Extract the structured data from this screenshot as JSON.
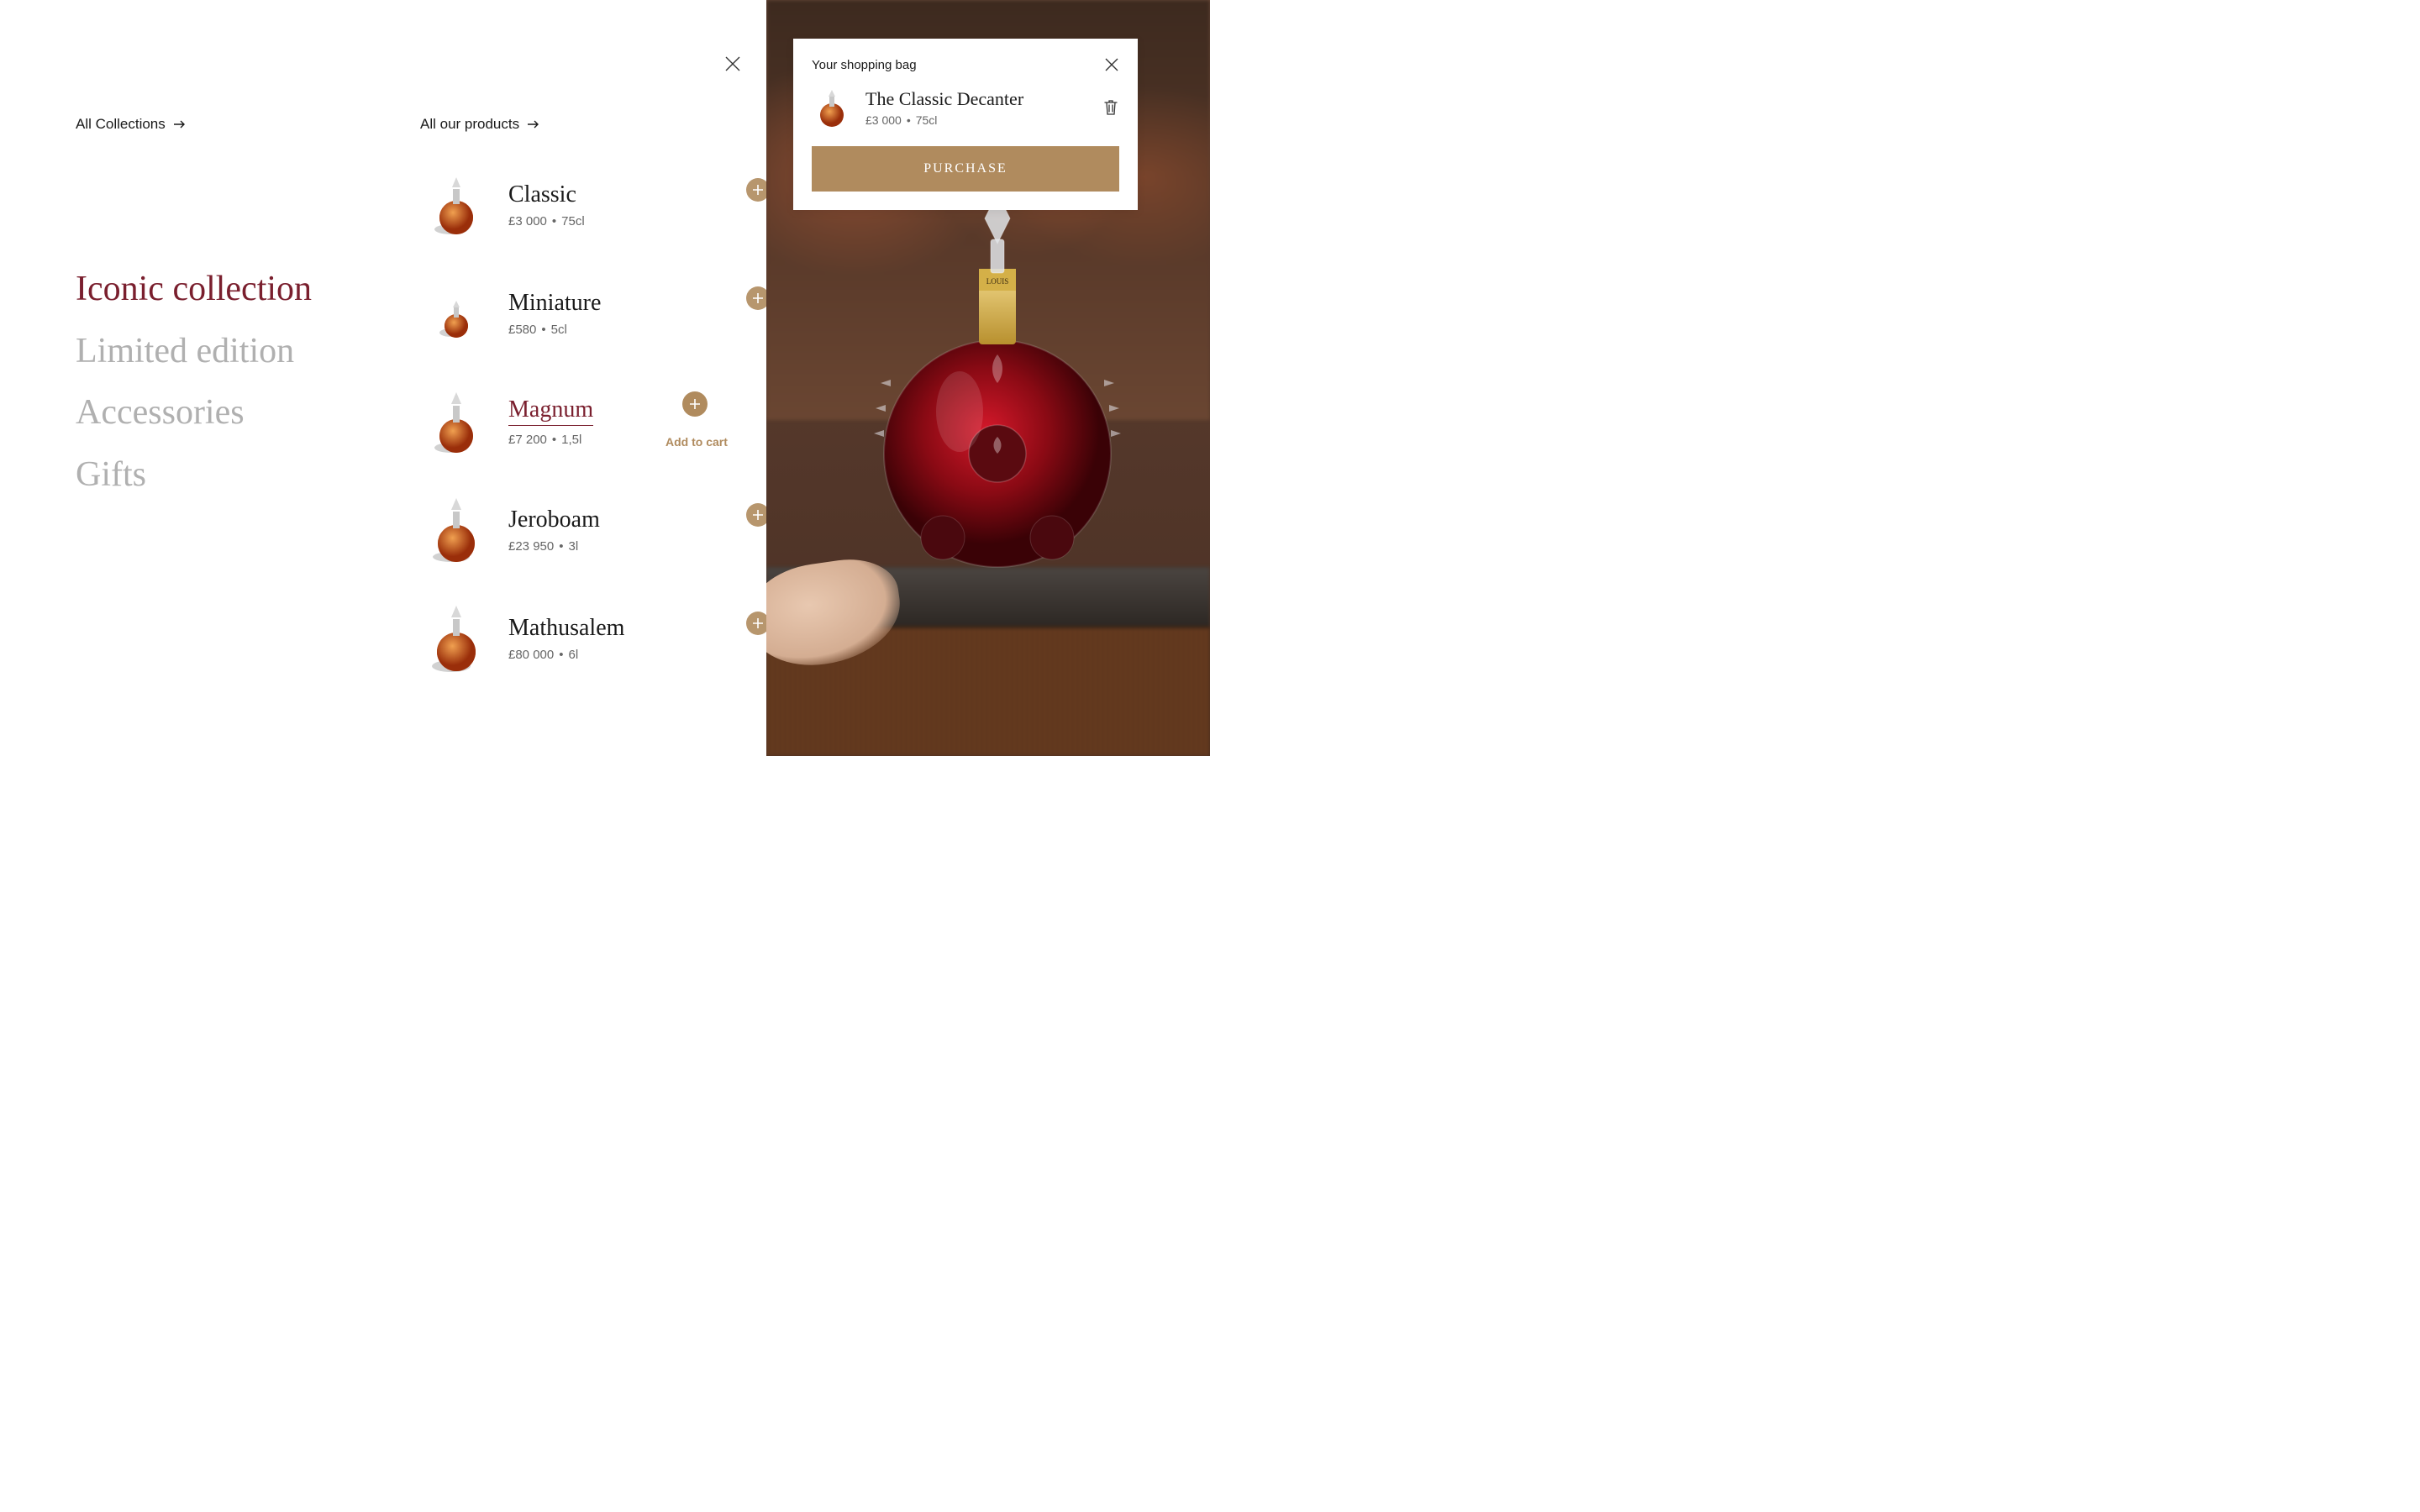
{
  "left": {
    "all_collections": "All Collections",
    "categories": [
      {
        "label": "Iconic collection",
        "active": true
      },
      {
        "label": "Limited edition",
        "active": false
      },
      {
        "label": "Accessories",
        "active": false
      },
      {
        "label": "Gifts",
        "active": false
      }
    ]
  },
  "mid": {
    "all_products": "All our products",
    "add_to_cart_label": "Add to cart",
    "products": [
      {
        "name": "Classic",
        "price": "£3 000",
        "size": "75cl",
        "highlight": false
      },
      {
        "name": "Miniature",
        "price": "£580",
        "size": "5cl",
        "highlight": false
      },
      {
        "name": "Magnum",
        "price": "£7 200",
        "size": "1,5l",
        "highlight": true
      },
      {
        "name": "Jeroboam",
        "price": "£23 950",
        "size": "3l",
        "highlight": false
      },
      {
        "name": "Mathusalem",
        "price": "£80 000",
        "size": "6l",
        "highlight": false
      }
    ]
  },
  "bag": {
    "title": "Your shopping bag",
    "item": {
      "name": "The Classic Decanter",
      "price": "£3 000",
      "size": "75cl"
    },
    "purchase": "PURCHASE"
  },
  "sep": "•"
}
